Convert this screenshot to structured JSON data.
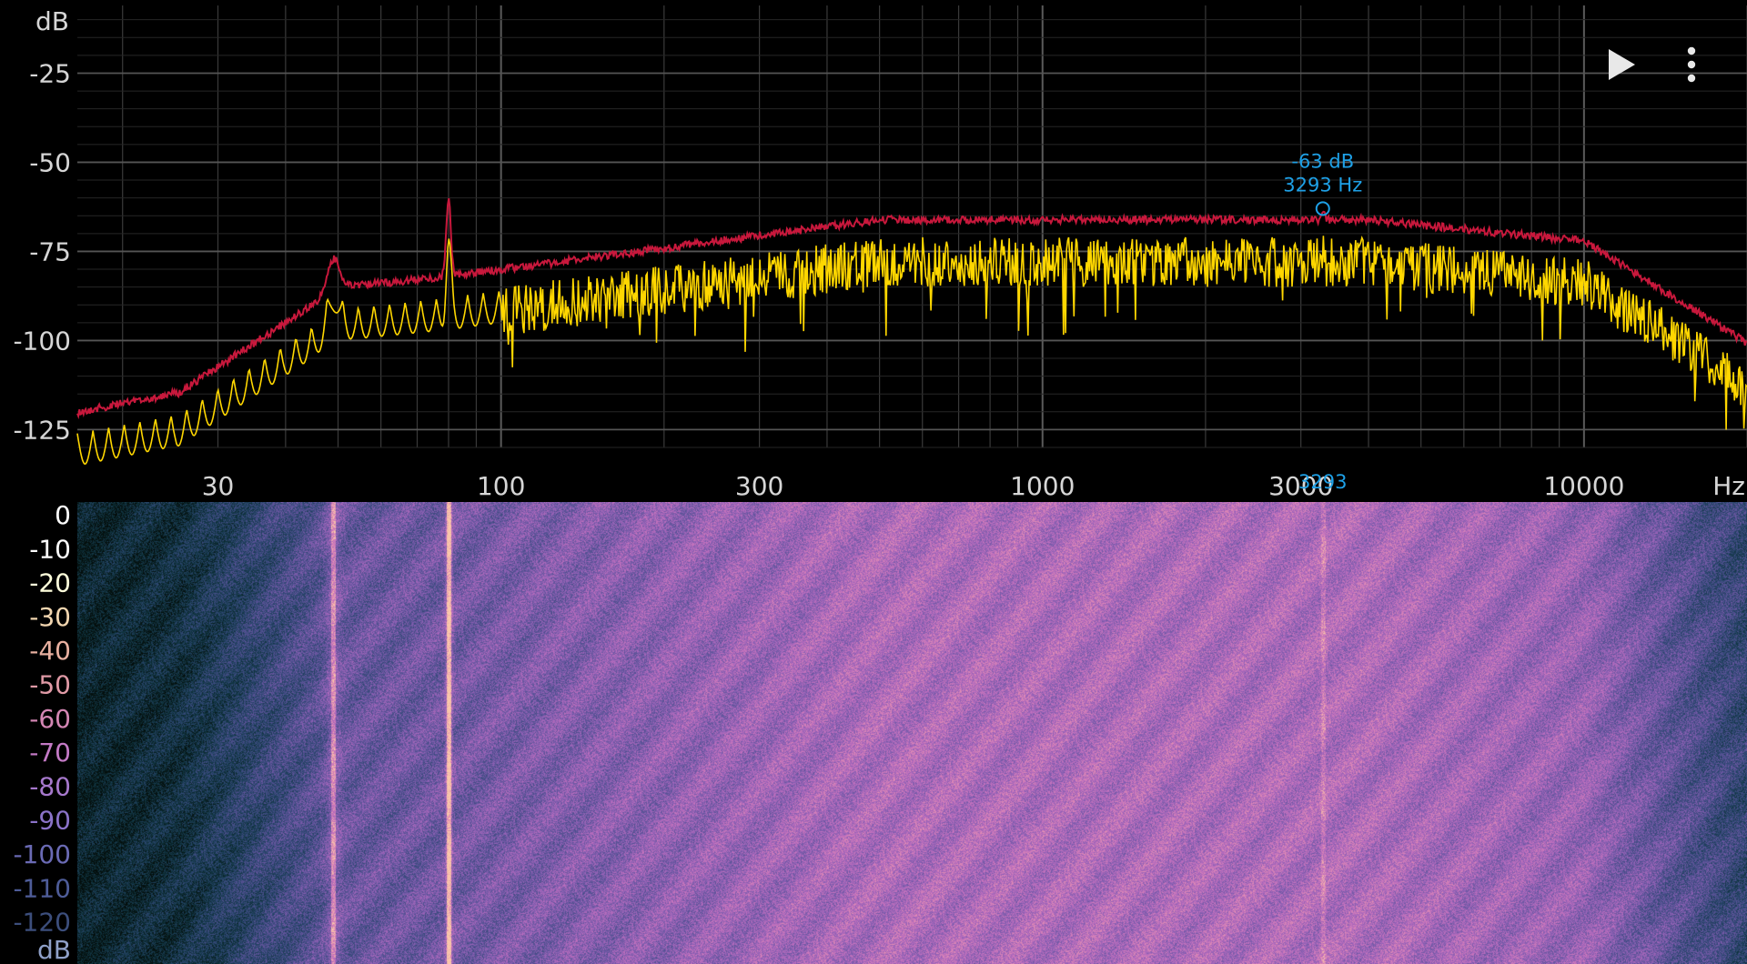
{
  "spectrum": {
    "unit_top": "dB",
    "y_ticks": [
      {
        "label": "-25",
        "value": -25
      },
      {
        "label": "-50",
        "value": -50
      },
      {
        "label": "-75",
        "value": -75
      },
      {
        "label": "-100",
        "value": -100
      },
      {
        "label": "-125",
        "value": -125
      }
    ],
    "x_ticks": [
      {
        "label": "30",
        "value": 30
      },
      {
        "label": "100",
        "value": 100
      },
      {
        "label": "300",
        "value": 300
      },
      {
        "label": "1000",
        "value": 1000
      },
      {
        "label": "3000",
        "value": 3000
      },
      {
        "label": "10000",
        "value": 10000
      }
    ],
    "x_unit": "Hz",
    "peak": {
      "db_label": "-63 dB",
      "hz_label": "3293 Hz",
      "axis_label": "3293",
      "freq_hz": 3293,
      "level_db": -63
    },
    "colors": {
      "peak_hold": "#c8183c",
      "live": "#ffd700",
      "marker": "#1ea0e6",
      "grid": "#3a3a3a"
    }
  },
  "spectrogram": {
    "scale_labels": [
      {
        "label": "0",
        "value": 0,
        "color": "#ffffff"
      },
      {
        "label": "-10",
        "value": -10,
        "color": "#ffffff"
      },
      {
        "label": "-20",
        "value": -20,
        "color": "#ffffdc"
      },
      {
        "label": "-30",
        "value": -30,
        "color": "#f2d6b0"
      },
      {
        "label": "-40",
        "value": -40,
        "color": "#e8b0a0"
      },
      {
        "label": "-50",
        "value": -50,
        "color": "#e09aa6"
      },
      {
        "label": "-60",
        "value": -60,
        "color": "#d486b4"
      },
      {
        "label": "-70",
        "value": -70,
        "color": "#c47ac6"
      },
      {
        "label": "-80",
        "value": -80,
        "color": "#a678cc"
      },
      {
        "label": "-90",
        "value": -90,
        "color": "#8a72c8"
      },
      {
        "label": "-100",
        "value": -100,
        "color": "#6a6ab4"
      },
      {
        "label": "-110",
        "value": -110,
        "color": "#4e5c98"
      },
      {
        "label": "-120",
        "value": -120,
        "color": "#3c4e7c"
      }
    ],
    "unit_label": "dB",
    "tonal_lines_hz": [
      49,
      80,
      3293
    ]
  },
  "controls": {
    "play_icon": "play-icon",
    "menu_icon": "more-vertical-icon"
  }
}
